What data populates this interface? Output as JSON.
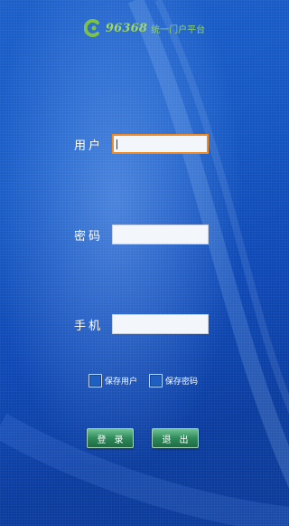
{
  "header": {
    "logo_number": "96368",
    "logo_subtitle": "统一门户平台"
  },
  "form": {
    "username": {
      "label": "用户",
      "value": ""
    },
    "password": {
      "label": "密码",
      "value": ""
    },
    "phone": {
      "label": "手机",
      "value": ""
    }
  },
  "options": {
    "save_user_label": "保存用户",
    "save_password_label": "保存密码"
  },
  "buttons": {
    "login_label": "登录",
    "exit_label": "退出"
  },
  "colors": {
    "focus_border": "#f08a24",
    "button_green": "#2f8a5a",
    "logo_green": "#9ed86a"
  }
}
